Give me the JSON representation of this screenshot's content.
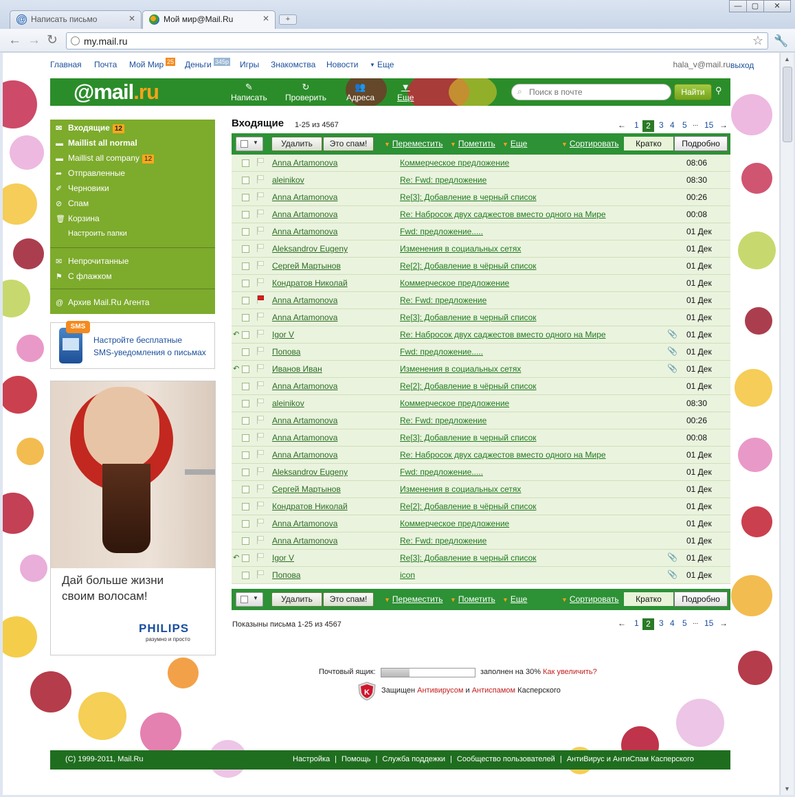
{
  "browser": {
    "tabs": [
      {
        "label": "Написать письмо",
        "active": false
      },
      {
        "label": "Мой мир@Mail.Ru",
        "active": true
      }
    ],
    "url": "my.mail.ru",
    "window_buttons": [
      "—",
      "▢",
      "✕"
    ]
  },
  "topnav": {
    "links": [
      "Главная",
      "Почта",
      "Мой Мир",
      "Деньги",
      "Игры",
      "Знакомства",
      "Новости",
      "Еще"
    ],
    "moimir_badge": "25",
    "dengi_badge": "345р",
    "user_email": "hala_v@mail.ru",
    "logout": "выход"
  },
  "header": {
    "logo_main": "@mail",
    "logo_suffix": ".ru",
    "buttons": [
      "Написать",
      "Проверить",
      "Адреса",
      "Еще"
    ],
    "search_placeholder": "Поиск в почте",
    "find_button": "Найти"
  },
  "sidebar": {
    "folders": [
      {
        "label": "Входящие",
        "badge": "12",
        "icon": "envelope-icon"
      },
      {
        "label": "Maillist all normal",
        "badge": "",
        "icon": "folder-icon"
      },
      {
        "label": "Maillist all company",
        "badge": "12",
        "icon": "folder-icon"
      },
      {
        "label": "Отправленные",
        "badge": "",
        "icon": "sent-arrow-icon"
      },
      {
        "label": "Черновики",
        "badge": "",
        "icon": "draft-icon"
      },
      {
        "label": "Спам",
        "badge": "",
        "icon": "spam-icon"
      },
      {
        "label": "Корзина",
        "badge": "",
        "icon": "trash-icon"
      }
    ],
    "configure": "Настроить папки",
    "filters": [
      {
        "label": "Непрочитанные",
        "icon": "unread-icon"
      },
      {
        "label": "С флажком",
        "icon": "flag-icon"
      }
    ],
    "archive": "Архив Mail.Ru Агента"
  },
  "sms": {
    "bubble": "SMS",
    "line1": "Настройте бесплатные",
    "line2": "SMS-уведомления о письмах"
  },
  "ad": {
    "line1": "Дай больше жизни",
    "line2": "своим волосам!",
    "brand": "PHILIPS",
    "tagline": "разумно и просто"
  },
  "main": {
    "title": "Входящие",
    "count": "1-25 из 4567",
    "pager": {
      "prev": "←",
      "pages": [
        "1",
        "2",
        "3",
        "4",
        "5"
      ],
      "current": "2",
      "ellipsis": "...",
      "last": "15",
      "next": "→"
    },
    "toolbar": {
      "delete": "Удалить",
      "spam": "Это спам!",
      "move": "Переместить",
      "mark": "Пометить",
      "more": "Еще",
      "sort": "Сортировать",
      "brief": "Кратко",
      "detailed": "Подробно"
    },
    "shown": "Показыны письма 1-25 из 4567"
  },
  "messages": [
    {
      "from": "Anna Artamonova",
      "subject": "Коммерческое предложение",
      "date": "08:06",
      "replied": false,
      "flag": false,
      "attach": false
    },
    {
      "from": "aleinikov",
      "subject": "Re: Fwd: предложение",
      "date": "08:30",
      "replied": false,
      "flag": false,
      "attach": false
    },
    {
      "from": "Anna Artamonova",
      "subject": "Re[3]: Добавление в черный список",
      "date": "00:26",
      "replied": false,
      "flag": false,
      "attach": false
    },
    {
      "from": "Anna Artamonova",
      "subject": "Re: Набросок двух саджестов вместо одного на Мире",
      "date": "00:08",
      "replied": false,
      "flag": false,
      "attach": false
    },
    {
      "from": "Anna Artamonova",
      "subject": "Fwd: предложение.....",
      "date": "01 Дек",
      "replied": false,
      "flag": false,
      "attach": false
    },
    {
      "from": "Aleksandrov Eugeny",
      "subject": "Изменения в социальных сетях",
      "date": "01 Дек",
      "replied": false,
      "flag": false,
      "attach": false
    },
    {
      "from": "Сергей Мартынов",
      "subject": "Re[2]: Добавление в чёрный список",
      "date": "01 Дек",
      "replied": false,
      "flag": false,
      "attach": false
    },
    {
      "from": "Кондратов Николай",
      "subject": "Коммерческое предложение",
      "date": "01 Дек",
      "replied": false,
      "flag": false,
      "attach": false
    },
    {
      "from": "Anna Artamonova",
      "subject": "Re: Fwd: предложение",
      "date": "01 Дек",
      "replied": false,
      "flag": true,
      "attach": false
    },
    {
      "from": "Anna Artamonova",
      "subject": "Re[3]: Добавление в черный список",
      "date": "01 Дек",
      "replied": false,
      "flag": false,
      "attach": false
    },
    {
      "from": "Igor V",
      "subject": "Re: Набросок двух саджестов вместо одного на Мире",
      "date": "01 Дек",
      "replied": true,
      "flag": false,
      "attach": true
    },
    {
      "from": "Попова",
      "subject": "Fwd: предложение.....",
      "date": "01 Дек",
      "replied": false,
      "flag": false,
      "attach": true
    },
    {
      "from": "Иванов Иван",
      "subject": "Изменения в социальных сетях",
      "date": "01 Дек",
      "replied": true,
      "flag": false,
      "attach": true
    },
    {
      "from": "Anna Artamonova",
      "subject": "Re[2]: Добавление в чёрный список",
      "date": "01 Дек",
      "replied": false,
      "flag": false,
      "attach": false
    },
    {
      "from": "aleinikov",
      "subject": "Коммерческое предложение",
      "date": "08:30",
      "replied": false,
      "flag": false,
      "attach": false
    },
    {
      "from": "Anna Artamonova",
      "subject": "Re: Fwd: предложение",
      "date": "00:26",
      "replied": false,
      "flag": false,
      "attach": false
    },
    {
      "from": "Anna Artamonova",
      "subject": "Re[3]: Добавление в черный список",
      "date": "00:08",
      "replied": false,
      "flag": false,
      "attach": false
    },
    {
      "from": "Anna Artamonova",
      "subject": "Re: Набросок двух саджестов вместо одного на Мире",
      "date": "01 Дек",
      "replied": false,
      "flag": false,
      "attach": false
    },
    {
      "from": "Aleksandrov Eugeny",
      "subject": "Fwd: предложение.....",
      "date": "01 Дек",
      "replied": false,
      "flag": false,
      "attach": false
    },
    {
      "from": "Сергей Мартынов",
      "subject": "Изменения в социальных сетях",
      "date": "01 Дек",
      "replied": false,
      "flag": false,
      "attach": false
    },
    {
      "from": "Кондратов Николай",
      "subject": "Re[2]: Добавление в чёрный список",
      "date": "01 Дек",
      "replied": false,
      "flag": false,
      "attach": false
    },
    {
      "from": "Anna Artamonova",
      "subject": "Коммерческое предложение",
      "date": "01 Дек",
      "replied": false,
      "flag": false,
      "attach": false
    },
    {
      "from": "Anna Artamonova",
      "subject": "Re: Fwd: предложение",
      "date": "01 Дек",
      "replied": false,
      "flag": false,
      "attach": false
    },
    {
      "from": "Igor V",
      "subject": "Re[3]: Добавление в черный список",
      "date": "01 Дек",
      "replied": true,
      "flag": false,
      "attach": true
    },
    {
      "from": "Попова",
      "subject": "icon",
      "date": "01 Дек",
      "replied": false,
      "flag": false,
      "attach": true
    }
  ],
  "quota": {
    "label": "Почтовый ящик:",
    "filled_fraction": 0.3,
    "text": "заполнен на 30%",
    "link": "Как увеличить?"
  },
  "kaspersky": {
    "prefix": "Защищен",
    "antivirus": "Антивирусом",
    "and": "и",
    "antispam": "Антиспамом",
    "suffix": "Касперского"
  },
  "footer": {
    "copyright": "(C) 1999-2011, Mail.Ru",
    "links": [
      "Настройка",
      "Помощь",
      "Служба поддежки",
      "Сообщество пользователей"
    ],
    "antivirus": "АнтиВирус",
    "and": "и",
    "antispam": "АнтиСпам",
    "suffix": "Касперского"
  },
  "colors": {
    "header_green": "#2b8d2a",
    "sidebar_green": "#7dab2c",
    "toolbar_green": "#2d9135",
    "footer_green": "#1f6e1f",
    "accent_orange": "#f9a71c",
    "flag_red": "#d61f1f"
  }
}
